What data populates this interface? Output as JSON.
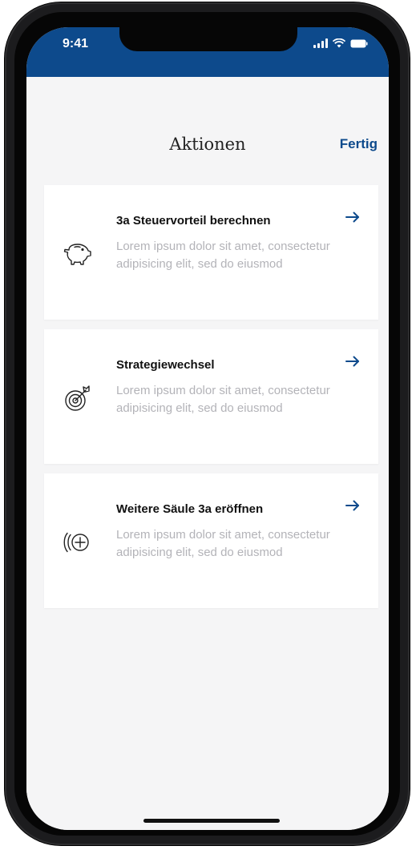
{
  "status_bar": {
    "time": "9:41"
  },
  "header": {
    "title": "Aktionen",
    "done_label": "Fertig"
  },
  "actions": [
    {
      "title": "3a Steuervorteil berechnen",
      "description": "Lorem ipsum dolor sit amet, consectetur adipisicing elit, sed do eiusmod",
      "icon": "piggy-bank-icon"
    },
    {
      "title": "Strategiewechsel",
      "description": "Lorem ipsum dolor sit amet, consectetur adipisicing elit, sed do eiusmod",
      "icon": "target-icon"
    },
    {
      "title": "Weitere Säule 3a eröffnen",
      "description": "Lorem ipsum dolor sit amet, consectetur adipisicing elit, sed do eiusmod",
      "icon": "add-account-icon"
    }
  ],
  "colors": {
    "brand": "#0d4a8c",
    "muted_text": "#b3b3b8",
    "background": "#f5f5f6"
  }
}
